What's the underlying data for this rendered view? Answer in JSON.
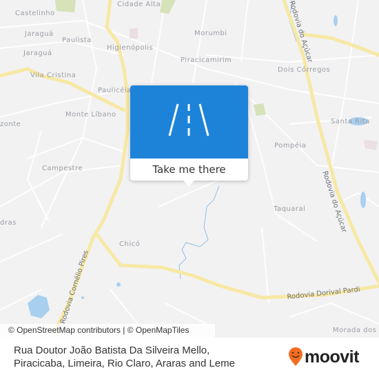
{
  "map": {
    "places": [
      {
        "name": "Castelinho"
      },
      {
        "name": "Jaraguá"
      },
      {
        "name": "Jaraguá"
      },
      {
        "name": "Paulista"
      },
      {
        "name": "Cidade Alta"
      },
      {
        "name": "Higienópolis"
      },
      {
        "name": "Vila Cristina"
      },
      {
        "name": "Paulicéia"
      },
      {
        "name": "Morumbi"
      },
      {
        "name": "Piracicamirim"
      },
      {
        "name": "Dois Córregos"
      },
      {
        "name": "Monte Líbano"
      },
      {
        "name": "Santa Rita"
      },
      {
        "name": "Pompéia"
      },
      {
        "name": "Campestre"
      },
      {
        "name": "Taquaral"
      },
      {
        "name": "Chicó"
      },
      {
        "name": "zonte"
      },
      {
        "name": "dras"
      },
      {
        "name": "Morada dos"
      }
    ],
    "roads": [
      {
        "name": "Rodovia do Açúcar"
      },
      {
        "name": "Rodovia do Açúcar"
      },
      {
        "name": "Rodovia Cornélio Pires"
      },
      {
        "name": "Rodovia Dorival Pardi"
      }
    ],
    "colors": {
      "background": "#f2f2f3",
      "major_road": "#f7e8a4",
      "water": "#a9cfee",
      "park": "#d6e2b8"
    }
  },
  "popup": {
    "icon": "road-icon",
    "button_label": "Take me there",
    "accent": "#1d83d9"
  },
  "attribution": "© OpenStreetMap contributors | © OpenMapTiles",
  "footer": {
    "address_line1": "Rua Doutor João Batista Da Silveira Mello,",
    "address_line2": "Piracicaba, Limeira, Rio Claro, Araras and Leme",
    "brand": "moovit",
    "brand_color": "#f36c21"
  }
}
